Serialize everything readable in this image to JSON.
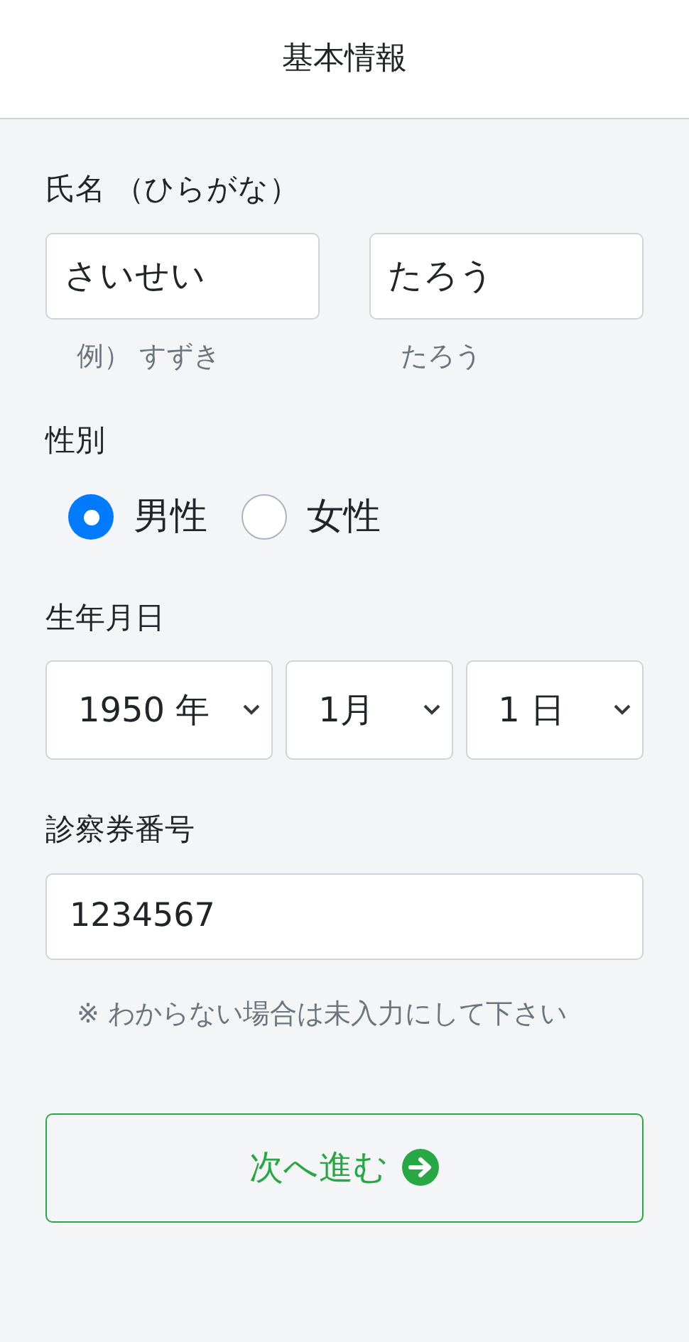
{
  "header": {
    "title": "基本情報"
  },
  "name": {
    "label": "氏名 （ひらがな）",
    "fields": [
      {
        "value": "さいせい",
        "hint": "例） すずき"
      },
      {
        "value": "たろう",
        "hint": "たろう"
      }
    ]
  },
  "gender": {
    "label": "性別",
    "options": [
      {
        "label": "男性",
        "selected": true
      },
      {
        "label": "女性",
        "selected": false
      }
    ]
  },
  "birthdate": {
    "label": "生年月日",
    "selects": [
      "1950 年",
      "1月",
      "1 日"
    ]
  },
  "card_number": {
    "label": "診察券番号",
    "value": "1234567",
    "note": "※ わからない場合は未入力にして下さい"
  },
  "next_button": {
    "label": "次へ進む"
  }
}
